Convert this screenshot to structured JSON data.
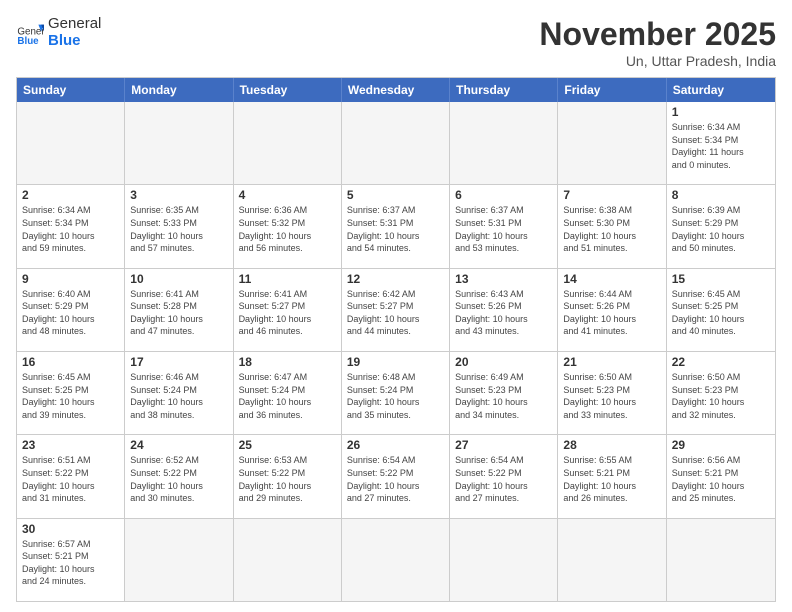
{
  "header": {
    "logo_general": "General",
    "logo_blue": "Blue",
    "month_title": "November 2025",
    "subtitle": "Un, Uttar Pradesh, India"
  },
  "calendar": {
    "days_of_week": [
      "Sunday",
      "Monday",
      "Tuesday",
      "Wednesday",
      "Thursday",
      "Friday",
      "Saturday"
    ],
    "rows": [
      [
        {
          "num": "",
          "info": "",
          "empty": true
        },
        {
          "num": "",
          "info": "",
          "empty": true
        },
        {
          "num": "",
          "info": "",
          "empty": true
        },
        {
          "num": "",
          "info": "",
          "empty": true
        },
        {
          "num": "",
          "info": "",
          "empty": true
        },
        {
          "num": "",
          "info": "",
          "empty": true
        },
        {
          "num": "1",
          "info": "Sunrise: 6:34 AM\nSunset: 5:34 PM\nDaylight: 11 hours\nand 0 minutes.",
          "empty": false
        }
      ],
      [
        {
          "num": "2",
          "info": "Sunrise: 6:34 AM\nSunset: 5:34 PM\nDaylight: 10 hours\nand 59 minutes.",
          "empty": false
        },
        {
          "num": "3",
          "info": "Sunrise: 6:35 AM\nSunset: 5:33 PM\nDaylight: 10 hours\nand 57 minutes.",
          "empty": false
        },
        {
          "num": "4",
          "info": "Sunrise: 6:36 AM\nSunset: 5:32 PM\nDaylight: 10 hours\nand 56 minutes.",
          "empty": false
        },
        {
          "num": "5",
          "info": "Sunrise: 6:37 AM\nSunset: 5:31 PM\nDaylight: 10 hours\nand 54 minutes.",
          "empty": false
        },
        {
          "num": "6",
          "info": "Sunrise: 6:37 AM\nSunset: 5:31 PM\nDaylight: 10 hours\nand 53 minutes.",
          "empty": false
        },
        {
          "num": "7",
          "info": "Sunrise: 6:38 AM\nSunset: 5:30 PM\nDaylight: 10 hours\nand 51 minutes.",
          "empty": false
        },
        {
          "num": "8",
          "info": "Sunrise: 6:39 AM\nSunset: 5:29 PM\nDaylight: 10 hours\nand 50 minutes.",
          "empty": false
        }
      ],
      [
        {
          "num": "9",
          "info": "Sunrise: 6:40 AM\nSunset: 5:29 PM\nDaylight: 10 hours\nand 48 minutes.",
          "empty": false
        },
        {
          "num": "10",
          "info": "Sunrise: 6:41 AM\nSunset: 5:28 PM\nDaylight: 10 hours\nand 47 minutes.",
          "empty": false
        },
        {
          "num": "11",
          "info": "Sunrise: 6:41 AM\nSunset: 5:27 PM\nDaylight: 10 hours\nand 46 minutes.",
          "empty": false
        },
        {
          "num": "12",
          "info": "Sunrise: 6:42 AM\nSunset: 5:27 PM\nDaylight: 10 hours\nand 44 minutes.",
          "empty": false
        },
        {
          "num": "13",
          "info": "Sunrise: 6:43 AM\nSunset: 5:26 PM\nDaylight: 10 hours\nand 43 minutes.",
          "empty": false
        },
        {
          "num": "14",
          "info": "Sunrise: 6:44 AM\nSunset: 5:26 PM\nDaylight: 10 hours\nand 41 minutes.",
          "empty": false
        },
        {
          "num": "15",
          "info": "Sunrise: 6:45 AM\nSunset: 5:25 PM\nDaylight: 10 hours\nand 40 minutes.",
          "empty": false
        }
      ],
      [
        {
          "num": "16",
          "info": "Sunrise: 6:45 AM\nSunset: 5:25 PM\nDaylight: 10 hours\nand 39 minutes.",
          "empty": false
        },
        {
          "num": "17",
          "info": "Sunrise: 6:46 AM\nSunset: 5:24 PM\nDaylight: 10 hours\nand 38 minutes.",
          "empty": false
        },
        {
          "num": "18",
          "info": "Sunrise: 6:47 AM\nSunset: 5:24 PM\nDaylight: 10 hours\nand 36 minutes.",
          "empty": false
        },
        {
          "num": "19",
          "info": "Sunrise: 6:48 AM\nSunset: 5:24 PM\nDaylight: 10 hours\nand 35 minutes.",
          "empty": false
        },
        {
          "num": "20",
          "info": "Sunrise: 6:49 AM\nSunset: 5:23 PM\nDaylight: 10 hours\nand 34 minutes.",
          "empty": false
        },
        {
          "num": "21",
          "info": "Sunrise: 6:50 AM\nSunset: 5:23 PM\nDaylight: 10 hours\nand 33 minutes.",
          "empty": false
        },
        {
          "num": "22",
          "info": "Sunrise: 6:50 AM\nSunset: 5:23 PM\nDaylight: 10 hours\nand 32 minutes.",
          "empty": false
        }
      ],
      [
        {
          "num": "23",
          "info": "Sunrise: 6:51 AM\nSunset: 5:22 PM\nDaylight: 10 hours\nand 31 minutes.",
          "empty": false
        },
        {
          "num": "24",
          "info": "Sunrise: 6:52 AM\nSunset: 5:22 PM\nDaylight: 10 hours\nand 30 minutes.",
          "empty": false
        },
        {
          "num": "25",
          "info": "Sunrise: 6:53 AM\nSunset: 5:22 PM\nDaylight: 10 hours\nand 29 minutes.",
          "empty": false
        },
        {
          "num": "26",
          "info": "Sunrise: 6:54 AM\nSunset: 5:22 PM\nDaylight: 10 hours\nand 27 minutes.",
          "empty": false
        },
        {
          "num": "27",
          "info": "Sunrise: 6:54 AM\nSunset: 5:22 PM\nDaylight: 10 hours\nand 27 minutes.",
          "empty": false
        },
        {
          "num": "28",
          "info": "Sunrise: 6:55 AM\nSunset: 5:21 PM\nDaylight: 10 hours\nand 26 minutes.",
          "empty": false
        },
        {
          "num": "29",
          "info": "Sunrise: 6:56 AM\nSunset: 5:21 PM\nDaylight: 10 hours\nand 25 minutes.",
          "empty": false
        }
      ],
      [
        {
          "num": "30",
          "info": "Sunrise: 6:57 AM\nSunset: 5:21 PM\nDaylight: 10 hours\nand 24 minutes.",
          "empty": false
        },
        {
          "num": "",
          "info": "",
          "empty": true
        },
        {
          "num": "",
          "info": "",
          "empty": true
        },
        {
          "num": "",
          "info": "",
          "empty": true
        },
        {
          "num": "",
          "info": "",
          "empty": true
        },
        {
          "num": "",
          "info": "",
          "empty": true
        },
        {
          "num": "",
          "info": "",
          "empty": true
        }
      ]
    ]
  }
}
